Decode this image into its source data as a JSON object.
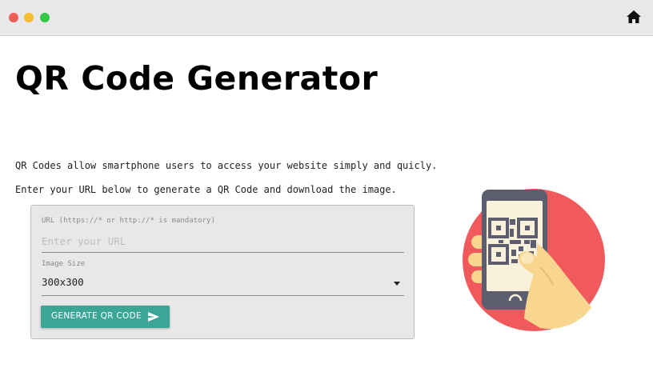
{
  "window": {
    "controls": [
      "close",
      "minimize",
      "maximize"
    ],
    "home_icon": "home-icon"
  },
  "header": {
    "title": "QR Code Generator"
  },
  "intro": {
    "line1": "QR Codes allow smartphone users to access your website simply and quicly.",
    "line2": "Enter your URL below to generate a QR Code and download the image."
  },
  "form": {
    "url_label": "URL (https://* or http://* is mandatory)",
    "url_placeholder": "Enter your URL",
    "url_value": "",
    "size_label": "Image Size",
    "size_value": "300x300",
    "submit_label": "GENERATE QR CODE",
    "submit_icon": "send-icon"
  },
  "illustration": {
    "icon": "phone-qr-code-illustration"
  },
  "colors": {
    "dot_red": "#ee5e58",
    "dot_yellow": "#f5bd2f",
    "dot_green": "#33c748",
    "button": "#3ba696",
    "circle": "#f15a5d",
    "phone": "#5c5d6e",
    "screen": "#faf1dc",
    "hand": "#f8d690"
  }
}
